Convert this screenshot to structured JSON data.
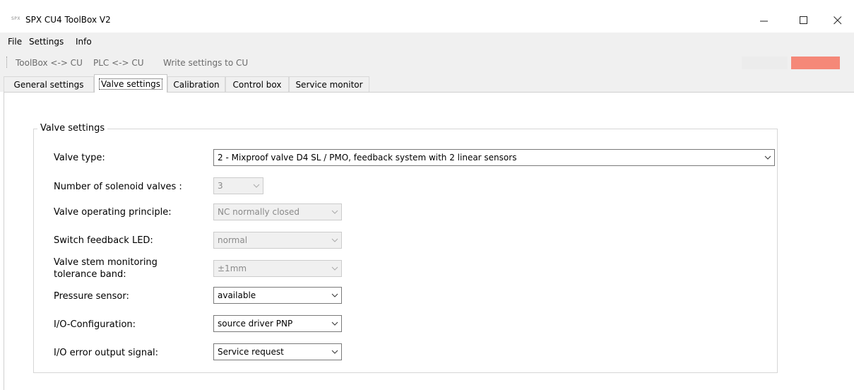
{
  "window": {
    "logo_text": "SPX",
    "title": "SPX CU4 ToolBox V2",
    "min_symbol": "—",
    "max_symbol": "☐",
    "close_symbol": "✕"
  },
  "menu": {
    "file": "File",
    "settings": "Settings",
    "info": "Info"
  },
  "toolbar": {
    "toolbox_cu": "ToolBox <-> CU",
    "plc_cu": "PLC <-> CU",
    "write": "Write settings to CU",
    "status_colors": [
      "#ececec",
      "#f58878"
    ]
  },
  "tabs": [
    {
      "label": "General settings",
      "active": false
    },
    {
      "label": "Valve settings",
      "active": true
    },
    {
      "label": "Calibration",
      "active": false
    },
    {
      "label": "Control box",
      "active": false
    },
    {
      "label": "Service monitor",
      "active": false
    }
  ],
  "group": {
    "title": "Valve settings",
    "fields": [
      {
        "label": "Valve type:",
        "value": "2 - Mixproof valve D4 SL / PMO, feedback system with 2 linear sensors",
        "enabled": true
      },
      {
        "label": "Number of solenoid valves :",
        "value": "3",
        "enabled": false
      },
      {
        "label": "Valve operating principle:",
        "value": "NC normally closed",
        "enabled": false
      },
      {
        "label": "Switch feedback LED:",
        "value": "normal",
        "enabled": false
      },
      {
        "label": "Valve stem monitoring\ntolerance band:",
        "value": "±1mm",
        "enabled": false
      },
      {
        "label": "Pressure sensor:",
        "value": "available",
        "enabled": true
      },
      {
        "label": "I/O-Configuration:",
        "value": "source driver PNP",
        "enabled": true
      },
      {
        "label": "I/O error output signal:",
        "value": "Service request",
        "enabled": true
      }
    ]
  },
  "icons": {
    "dropdown": "chevron-down-icon"
  }
}
